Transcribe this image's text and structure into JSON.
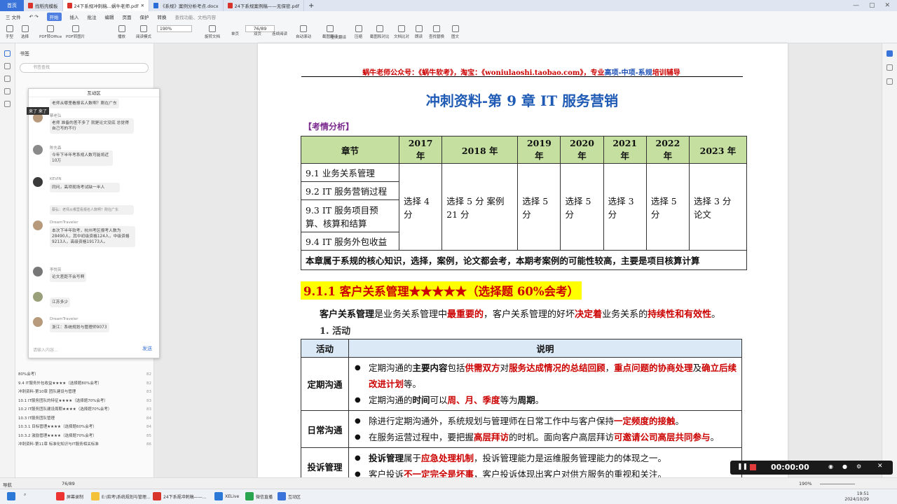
{
  "titlebar": {
    "home": "首页",
    "tabs": [
      {
        "label": "找稻壳模板",
        "color": "#d9342b"
      },
      {
        "label": "24下系规冲刺稿...蜗牛老师.pdf",
        "color": "#d9342b",
        "active": true
      },
      {
        "label": "《系规》案例分析考点.docx",
        "color": "#2b6cd9"
      },
      {
        "label": "24下系规案例稿——无保密.pdf",
        "color": "#d9342b"
      }
    ],
    "new_tab": "+"
  },
  "menubar": {
    "file": "三 文件",
    "items": [
      "开始",
      "插入",
      "批注",
      "编辑",
      "页面",
      "保护",
      "转换"
    ],
    "highlight": "开始",
    "search": "查找功能、文档内容"
  },
  "toolbar": {
    "buttons": [
      "手型",
      "选择",
      "PDF转Office",
      "PDF转图片",
      "播放",
      "阅读模式",
      "旋转文档",
      "单页",
      "双页",
      "连续阅读",
      "自动滚动",
      "截图翻译",
      "全文翻译",
      "压缩",
      "截图和对比",
      "文档比对",
      "朗读",
      "查找替换",
      "图文"
    ],
    "zoom": "190%",
    "page": "76/89"
  },
  "leftpanel": {
    "title": "书签",
    "search_placeholder": "书签查找",
    "outline": [
      {
        "text": "80%会考）",
        "page": "82"
      },
      {
        "text": "9.4 IT服务外包收益★★★★（选择题80%会考）",
        "page": "82"
      },
      {
        "text": "冲刺资料-第10章 团队建设与管理",
        "page": "83"
      },
      {
        "text": "10.1 IT服务团队的特征★★★★（选择题70%会考）",
        "page": "83"
      },
      {
        "text": "10.2 IT服务团队建设周期★★★★（选择题70%会考）",
        "page": "83"
      },
      {
        "text": "10.3 IT服务团队管理",
        "page": "84"
      },
      {
        "text": "10.3.1 目标管理★★★★（选择题60%会考）",
        "page": "84"
      },
      {
        "text": "10.3.2 激励管理★★★★（选择题70%会考）",
        "page": "85"
      },
      {
        "text": "冲刺资料-第11章 标准化知识与IT服务相关标准",
        "page": "86"
      }
    ]
  },
  "chat": {
    "title": "互动区",
    "tag": "来了 来了",
    "messages": [
      {
        "user": "",
        "text": "老师从哪里看报名人数啊？刚在广东"
      },
      {
        "user": "蔡老弘",
        "text": "老师 准备的差不多了 就是论文没底 总觉得自己写的不行"
      },
      {
        "user": "陈先森",
        "text": "今年下半年考系规人数可能将近10万"
      },
      {
        "user": "KEVIN",
        "text": "同问，高项现场考试缺一半人"
      },
      {
        "user": "",
        "text": "蔡弘：老师从哪里看报名人数啊？刚在广东"
      },
      {
        "user": "DreamTraveler",
        "text": "本次下半年软考，杭州考区报考人数为28490人，其中初级资格124人，中级资格9213人，高级资格19173人。"
      },
      {
        "user": "李悦亮",
        "text": "论文差距不会写啊"
      },
      {
        "user": "",
        "text": "江苏多少"
      },
      {
        "user": "DreamTraveler",
        "text": "浙江：系统规划与管理师9073"
      }
    ],
    "input_placeholder": "请输入内容…",
    "send": "发送"
  },
  "document": {
    "header_red_1": "蜗牛老师公众号：《蜗牛软考》，淘宝：《woniulaoshi.taobao.com》，专业",
    "header_blue": "高项-中项-系规",
    "header_red_2": "培训辅导",
    "title": "冲刺资料-第 9 章  IT 服务营销",
    "exam_analysis": "【考情分析】",
    "table1": {
      "headers": [
        "章节",
        "2017 年",
        "2018 年",
        "2019 年",
        "2020 年",
        "2021 年",
        "2022 年",
        "2023 年"
      ],
      "chapters": [
        "9.1  业务关系管理",
        "9.2 IT 服务营销过程",
        "9.3 IT 服务项目预算、核算和结算",
        "9.4 IT 服务外包收益"
      ],
      "scores": [
        "选择 4 分",
        "选择 5 分 案例 21 分",
        "选择 5 分",
        "选择 5 分",
        "选择 3 分",
        "选择 5 分",
        "选择 3 分 论文"
      ],
      "note": "本章属于系规的核心知识，选择，案例，论文都会考，本期考案例的可能性较高，主要是项目核算计算"
    },
    "section": "9.1.1  客户关系管理★★★★★（选择题 60%会考）",
    "intro_1": "客户关系管理",
    "intro_2": "是业务关系管理中",
    "intro_3": "最重要的",
    "intro_4": "，客户关系管理的好坏",
    "intro_5": "决定着",
    "intro_6": "业务关系的",
    "intro_7": "持续性和有效性",
    "intro_8": "。",
    "sub1": "1.  活动",
    "table2": {
      "headers": [
        "活动",
        "说明"
      ],
      "rows": [
        {
          "activity": "定期沟通"
        },
        {
          "activity": "日常沟通"
        },
        {
          "activity": "投诉管理"
        }
      ]
    }
  },
  "statusbar": {
    "left": "导航",
    "page": "76/89",
    "zoom": "190%"
  },
  "recorder": {
    "time": "00:00:00"
  },
  "taskbar": {
    "apps": [
      "屏幕录制",
      "E:\\软考\\系统规划与管理...",
      "24下系规冲刺稿——...",
      "XELive",
      "微信直播",
      "互动区"
    ],
    "time": "19:51",
    "date": "2024/10/29"
  }
}
